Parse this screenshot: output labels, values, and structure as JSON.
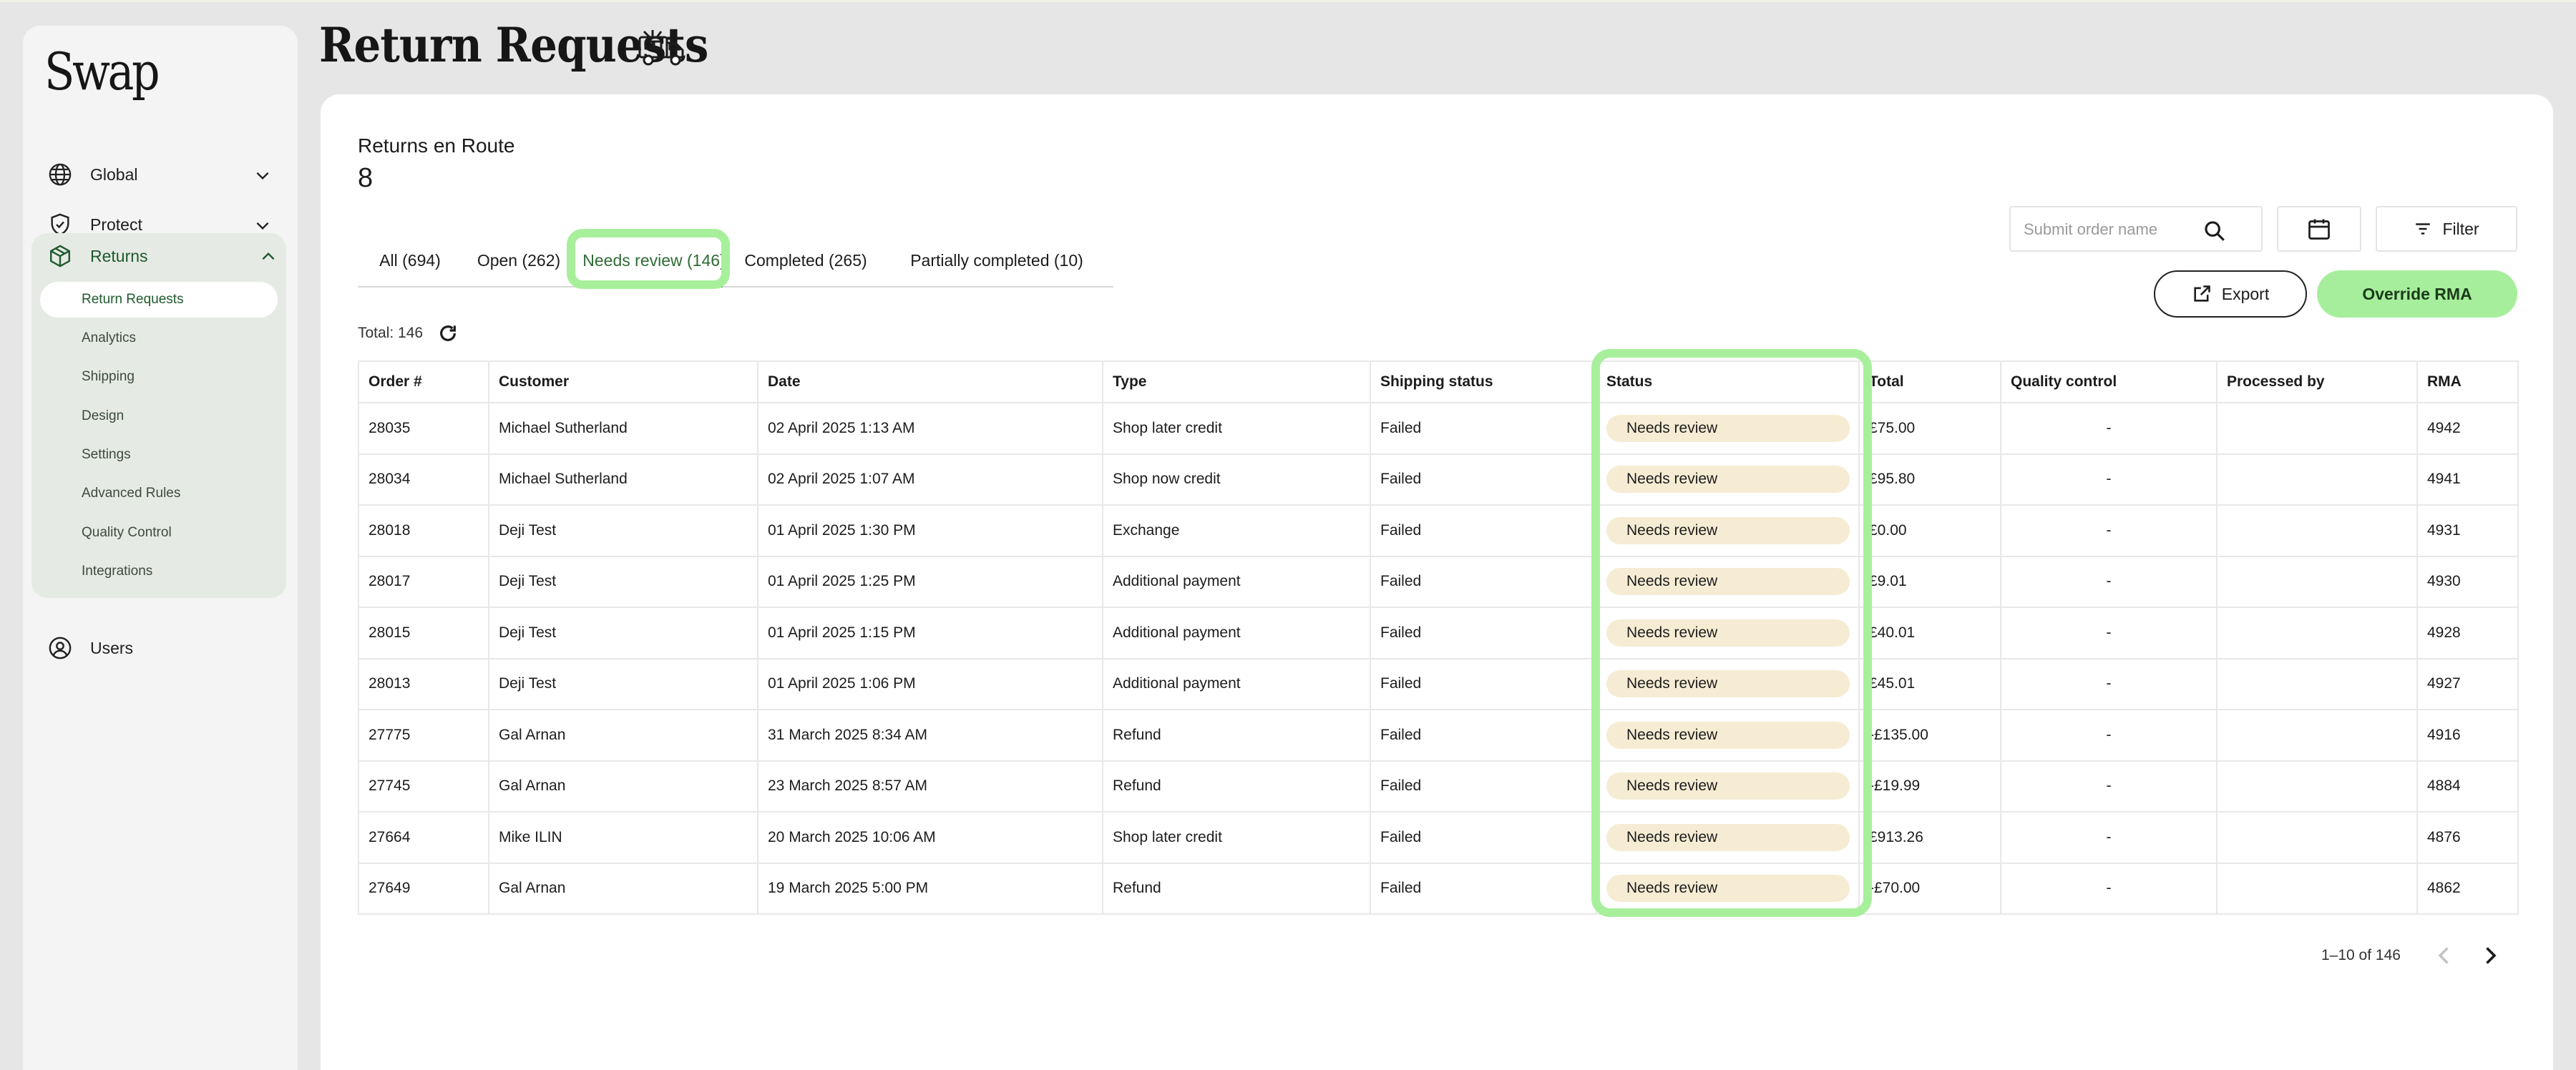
{
  "brand": {
    "logo_text": "Swap"
  },
  "sidebar": {
    "items": [
      {
        "label": "Global",
        "icon": "globe-icon"
      },
      {
        "label": "Protect",
        "icon": "shield-check-icon"
      },
      {
        "label": "Returns",
        "icon": "box-icon"
      },
      {
        "label": "Users",
        "icon": "user-circle-icon"
      }
    ],
    "returns_sub": [
      {
        "label": "Return Requests",
        "active": true
      },
      {
        "label": "Analytics"
      },
      {
        "label": "Shipping"
      },
      {
        "label": "Design"
      },
      {
        "label": "Settings"
      },
      {
        "label": "Advanced Rules"
      },
      {
        "label": "Quality Control"
      },
      {
        "label": "Integrations"
      }
    ]
  },
  "page": {
    "title": "Return Requests",
    "title_icon": "delivery-truck-icon"
  },
  "summary": {
    "label": "Returns en Route",
    "count": "8"
  },
  "tabs": [
    {
      "label": "All (694)"
    },
    {
      "label": "Open (262)"
    },
    {
      "label": "Needs review (146)",
      "active": true
    },
    {
      "label": "Completed (265)"
    },
    {
      "label": "Partially completed (10)"
    }
  ],
  "toolbar": {
    "search_placeholder": "Submit order name",
    "filter_label": "Filter",
    "export_label": "Export",
    "override_label": "Override RMA"
  },
  "total_label": "Total: 146",
  "table": {
    "columns": [
      "Order #",
      "Customer",
      "Date",
      "Type",
      "Shipping status",
      "Status",
      "Total",
      "Quality control",
      "Processed by",
      "RMA"
    ],
    "rows": [
      [
        "28035",
        "Michael Sutherland",
        "02 April 2025 1:13 AM",
        "Shop later credit",
        "Failed",
        "Needs review",
        "£75.00",
        "-",
        "",
        "4942"
      ],
      [
        "28034",
        "Michael Sutherland",
        "02 April 2025 1:07 AM",
        "Shop now credit",
        "Failed",
        "Needs review",
        "£95.80",
        "-",
        "",
        "4941"
      ],
      [
        "28018",
        "Deji Test",
        "01 April 2025 1:30 PM",
        "Exchange",
        "Failed",
        "Needs review",
        "£0.00",
        "-",
        "",
        "4931"
      ],
      [
        "28017",
        "Deji Test",
        "01 April 2025 1:25 PM",
        "Additional payment",
        "Failed",
        "Needs review",
        "£9.01",
        "-",
        "",
        "4930"
      ],
      [
        "28015",
        "Deji Test",
        "01 April 2025 1:15 PM",
        "Additional payment",
        "Failed",
        "Needs review",
        "£40.01",
        "-",
        "",
        "4928"
      ],
      [
        "28013",
        "Deji Test",
        "01 April 2025 1:06 PM",
        "Additional payment",
        "Failed",
        "Needs review",
        "£45.01",
        "-",
        "",
        "4927"
      ],
      [
        "27775",
        "Gal Arnan",
        "31 March 2025 8:34 AM",
        "Refund",
        "Failed",
        "Needs review",
        "-£135.00",
        "-",
        "",
        "4916"
      ],
      [
        "27745",
        "Gal Arnan",
        "23 March 2025 8:57 AM",
        "Refund",
        "Failed",
        "Needs review",
        "-£19.99",
        "-",
        "",
        "4884"
      ],
      [
        "27664",
        "Mike ILIN",
        "20 March 2025 10:06 AM",
        "Shop later credit",
        "Failed",
        "Needs review",
        "£913.26",
        "-",
        "",
        "4876"
      ],
      [
        "27649",
        "Gal Arnan",
        "19 March 2025 5:00 PM",
        "Refund",
        "Failed",
        "Needs review",
        "-£70.00",
        "-",
        "",
        "4862"
      ]
    ]
  },
  "pagination": {
    "range_text": "1–10 of 146"
  },
  "colors": {
    "accent_green": "#a6ee9c",
    "active_text": "#2e6b34",
    "badge_bg": "#f5ecd3"
  }
}
